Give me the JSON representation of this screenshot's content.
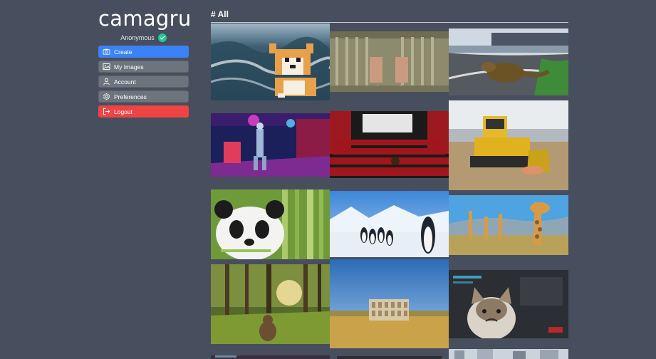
{
  "brand": {
    "title": "camagru"
  },
  "user": {
    "name": "Anonymous"
  },
  "menu": {
    "create": "Create",
    "my_images": "My Images",
    "account": "Account",
    "preferences": "Preferences",
    "logout": "Logout"
  },
  "main": {
    "title": "# All"
  },
  "colors": {
    "background": "#474e5d",
    "primary": "#3b82f6",
    "danger": "#ef4444",
    "secondary": "#6c757d",
    "verified": "#20c997"
  },
  "gallery": {
    "images": [
      {
        "subject": "stormy-ocean-corgi-sticker"
      },
      {
        "subject": "jail-hands-cuffed"
      },
      {
        "subject": "komodo-dragon-racetrack"
      },
      {
        "subject": "dancer-neon-room"
      },
      {
        "subject": "cinema-red-seats"
      },
      {
        "subject": "bulldozer-cat"
      },
      {
        "subject": "panda-bamboo"
      },
      {
        "subject": "penguins-ice"
      },
      {
        "subject": "giraffes-savanna"
      },
      {
        "subject": "forest-bear"
      },
      {
        "subject": "colosseum-field"
      },
      {
        "subject": "grumpy-cat-game"
      },
      {
        "subject": "dark-bottom-tile"
      },
      {
        "subject": "dark-bottom-tile-2"
      },
      {
        "subject": "city-street"
      }
    ]
  }
}
